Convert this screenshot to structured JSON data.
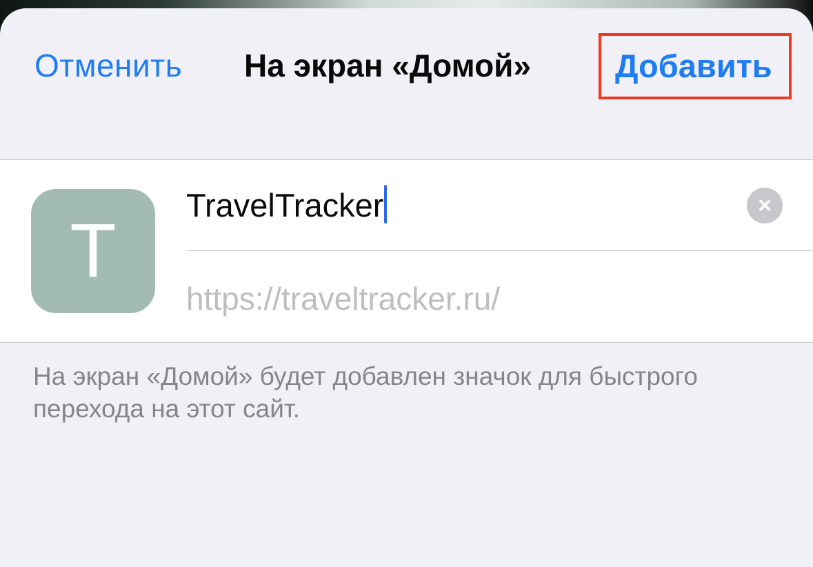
{
  "nav": {
    "cancel_label": "Отменить",
    "title": "На экран «Домой»",
    "add_label": "Добавить"
  },
  "bookmark": {
    "icon_letter": "T",
    "icon_color": "#a2bbb3",
    "name_value": "TravelTracker",
    "url": "https://traveltracker.ru/",
    "clear_icon": "clear-icon"
  },
  "footer": {
    "note": "На экран «Домой» будет добавлен значок для быстрого перехода на этот сайт."
  },
  "colors": {
    "accent": "#1f7cf3",
    "highlight": "#f23820",
    "cursor": "#2e6ae6"
  }
}
